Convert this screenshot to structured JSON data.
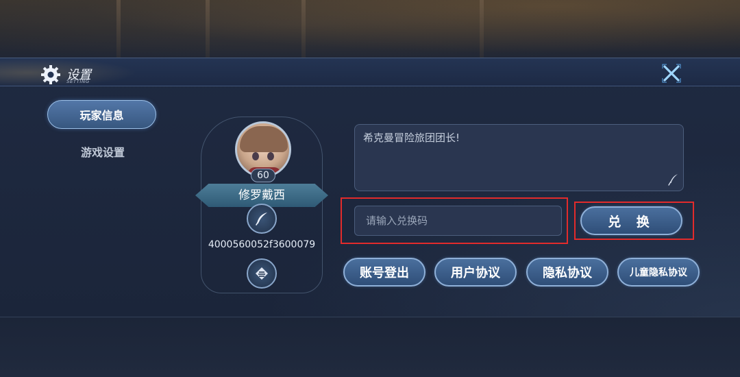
{
  "header": {
    "title": "设置",
    "subtitle": "SETTING",
    "close_icon": "close-x-icon",
    "gear_icon": "gear-icon"
  },
  "sidebar": {
    "tabs": [
      {
        "label": "玩家信息",
        "active": true
      },
      {
        "label": "游戏设置",
        "active": false
      }
    ]
  },
  "profile": {
    "level": "60",
    "name": "修罗戴西",
    "user_id": "4000560052f3600079",
    "edit_icon": "quill-pen-icon",
    "rank_icon": "rank-emblem-icon"
  },
  "signature": {
    "text": "希克曼冒险旅团团长!",
    "edit_icon": "quill-pen-icon"
  },
  "redeem": {
    "placeholder": "请输入兑换码",
    "button_label": "兑 换"
  },
  "actions": [
    {
      "label": "账号登出"
    },
    {
      "label": "用户协议"
    },
    {
      "label": "隐私协议"
    },
    {
      "label": "儿童隐私协议"
    }
  ],
  "colors": {
    "accent_blue": "#4a6f9d",
    "highlight_red": "#e32b2b",
    "panel_bg": "#1f2a41"
  }
}
